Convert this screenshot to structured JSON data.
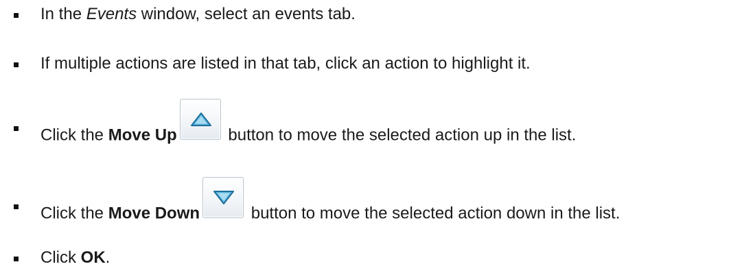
{
  "steps": [
    {
      "before": "In the ",
      "emphasis": "Events",
      "after": " window, select an events tab."
    },
    {
      "text": "If multiple actions are listed in that tab, click an action to highlight it."
    },
    {
      "before": "Click the ",
      "bold": "Move Up",
      "after": " button to move the selected action up in the list.",
      "icon": "move-up-icon"
    },
    {
      "before": "Click the ",
      "bold": "Move Down",
      "after": " button to move the selected action down in the list.",
      "icon": "move-down-icon"
    },
    {
      "before": "Click ",
      "bold": "OK",
      "after": "."
    }
  ],
  "colors": {
    "icon_fill": "#5fb6de",
    "icon_stroke": "#1f6f9b",
    "button_border": "#b9c3cc"
  }
}
